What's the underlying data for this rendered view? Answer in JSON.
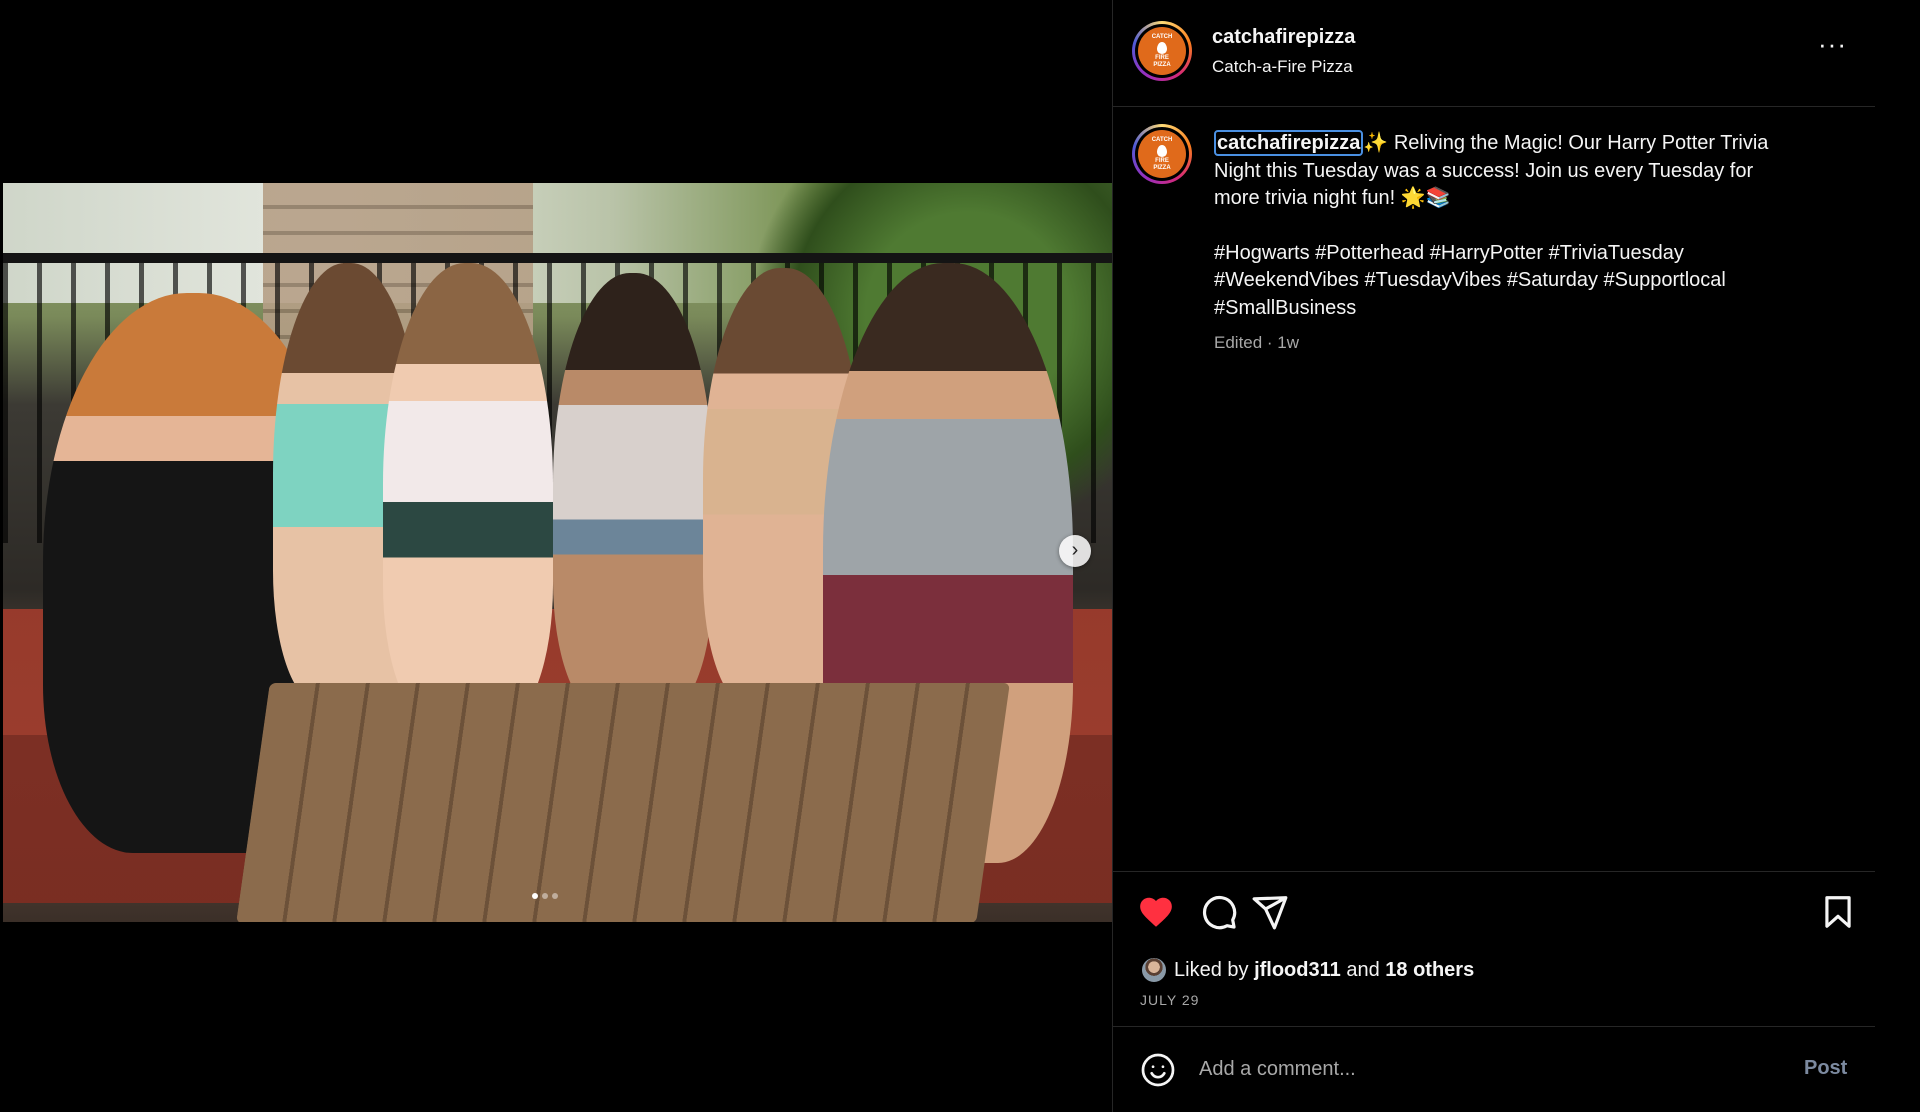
{
  "header": {
    "username": "catchafirepizza",
    "subtitle": "Catch-a-Fire Pizza",
    "more_label": "···"
  },
  "avatar_logo_text": {
    "top": "CATCH",
    "middle": "FIRE",
    "bottom": "PIZZA"
  },
  "caption": {
    "username": "catchafirepizza",
    "text_line1": "✨ Reliving the Magic! Our Harry Potter Trivia",
    "text_line2": "Night this Tuesday was a success! Join us every Tuesday for",
    "text_line3": "more trivia night fun! 🌟📚",
    "hashtags_line1": [
      "#Hogwarts",
      "#Potterhead",
      "#HarryPotter",
      "#TriviaTuesday"
    ],
    "hashtags_line2": [
      "#WeekendVibes",
      "#TuesdayVibes",
      "#Saturday",
      "#Supportlocal"
    ],
    "hashtags_line3": [
      "#SmallBusiness"
    ],
    "edited": "Edited · 1w"
  },
  "carousel": {
    "next_label": "›",
    "slide_count": 3,
    "active_index": 0
  },
  "actions": {
    "liked": true,
    "like_icon": "heart-icon",
    "comment_icon": "comment-icon",
    "share_icon": "paper-plane-icon",
    "save_icon": "bookmark-icon",
    "like_color": "#ff3040"
  },
  "likes": {
    "prefix": "Liked by",
    "first_liker": "jflood311",
    "conjunction": "and",
    "others": "18 others"
  },
  "post_date": "JULY 29",
  "comment_box": {
    "placeholder": "Add a comment...",
    "post_label": "Post",
    "emoji_icon": "smiley-icon"
  },
  "colors": {
    "background": "#000000",
    "text": "#f5f5f5",
    "muted": "#a8a8a8",
    "divider": "#262626",
    "brand": "#e06a1b",
    "post_button": "#7c8aa0"
  }
}
